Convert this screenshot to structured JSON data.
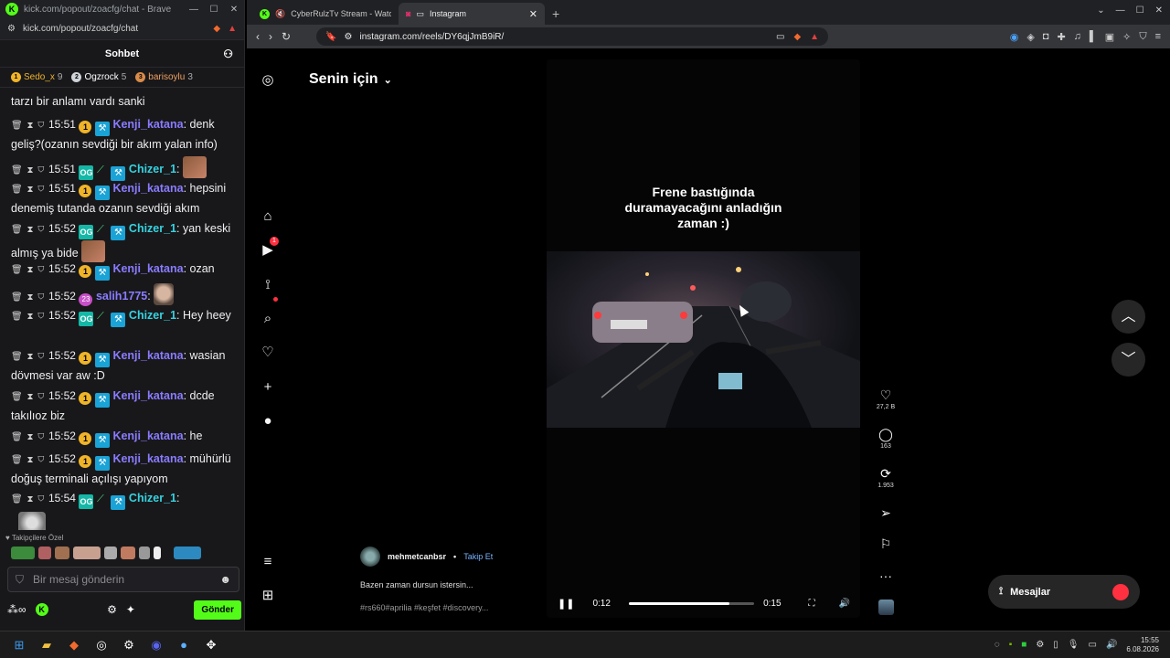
{
  "left_window": {
    "title": "kick.com/popout/zoacfg/chat - Brave",
    "url": "kick.com/popout/zoacfg/chat",
    "header": "Sohbet",
    "leaderboard": [
      {
        "rank": "1",
        "name": "Sedo_x",
        "count": "9",
        "color": "#f0b429"
      },
      {
        "rank": "2",
        "name": "Ogzrock",
        "count": "5",
        "color": "#cfd3da"
      },
      {
        "rank": "3",
        "name": "barisoylu",
        "count": "3",
        "color": "#d98b4a"
      }
    ],
    "messages": [
      {
        "time": "",
        "user": "",
        "text": "tarzı bir anlamı vardı sanki"
      },
      {
        "time": "15:51",
        "user": "Kenji_katana",
        "text": "denk geliş?(ozanın sevdiği bir akım yalan info)"
      },
      {
        "time": "15:51",
        "user": "Chizer_1",
        "text": ""
      },
      {
        "time": "15:51",
        "user": "Kenji_katana",
        "text": "hepsini denemiş tutanda ozanın sevdiği akım"
      },
      {
        "time": "15:52",
        "user": "Chizer_1",
        "text": "yan keski almış ya bide"
      },
      {
        "time": "15:52",
        "user": "Kenji_katana",
        "text": "ozan"
      },
      {
        "time": "15:52",
        "user": "salih1775",
        "text": ""
      },
      {
        "time": "15:52",
        "user": "Chizer_1",
        "text": "Hey heey"
      },
      {
        "time": "15:52",
        "user": "Kenji_katana",
        "text": "wasian dövmesi var aw :D"
      },
      {
        "time": "15:52",
        "user": "Kenji_katana",
        "text": "dcde takılıoz biz"
      },
      {
        "time": "15:52",
        "user": "Kenji_katana",
        "text": "he"
      },
      {
        "time": "15:52",
        "user": "Kenji_katana",
        "text": "mühürlü doğuş terminali açılışı yapıyom"
      },
      {
        "time": "15:54",
        "user": "Chizer_1",
        "text": ""
      }
    ],
    "badge_sub": "23",
    "badge_og": "OG",
    "badge_one": "1",
    "followers_label": "Takipçilere Özel",
    "input_placeholder": "Bir mesaj gönderin",
    "send_label": "Gönder"
  },
  "right_window": {
    "tabs": [
      {
        "label": "CyberRulzTv Stream - Watch Live",
        "active": false
      },
      {
        "label": "Instagram",
        "active": true
      }
    ],
    "url": "instagram.com/reels/DY6qjJmB9iR/",
    "feed_title": "Senin için",
    "notif_count": "1",
    "reel": {
      "overlay_text": "Frene bastığında duramayacağını anladığın zaman :)",
      "author": "mehmetcanbsr",
      "separator": "•",
      "follow_label": "Takip Et",
      "caption": "Bazen zaman dursun istersin...",
      "hashtags": "#rs660#aprilia #keşfet #discovery...",
      "current_time": "0:12",
      "total_time": "0:15",
      "progress": 0.8,
      "likes": "27,2 B",
      "comments": "163",
      "reposts": "1.953"
    },
    "messages_label": "Mesajlar"
  },
  "taskbar": {
    "time": "15:55",
    "date": "6.08.2026"
  }
}
